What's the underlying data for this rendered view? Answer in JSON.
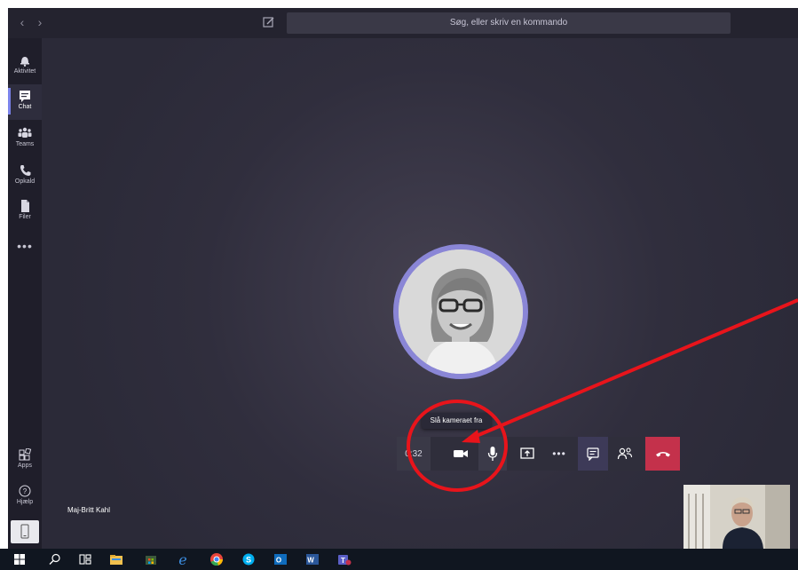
{
  "topbar": {
    "back_icon": "chevron-left-icon",
    "forward_icon": "chevron-right-icon",
    "compose_icon": "compose-icon",
    "search_placeholder": "Søg, eller skriv en kommando"
  },
  "rail": {
    "items": [
      {
        "label": "Aktivitet",
        "icon": "bell-icon",
        "active": false
      },
      {
        "label": "Chat",
        "icon": "chat-icon",
        "active": true
      },
      {
        "label": "Teams",
        "icon": "teams-icon",
        "active": false
      },
      {
        "label": "Opkald",
        "icon": "phone-icon",
        "active": false
      },
      {
        "label": "Filer",
        "icon": "file-icon",
        "active": false
      }
    ],
    "more": "•••",
    "bottom_items": [
      {
        "label": "Apps",
        "icon": "apps-icon"
      },
      {
        "label": "Hjælp",
        "icon": "help-icon"
      }
    ],
    "device_icon": "mobile-device-icon"
  },
  "call": {
    "participant_name": "Maj-Britt Kahl",
    "timer": "0:32",
    "tooltip": "Slå kameraet fra",
    "controls": {
      "camera_icon": "video-camera-icon",
      "mic_icon": "microphone-icon",
      "share_icon": "share-screen-icon",
      "more_label": "•••",
      "chat_icon": "conversation-icon",
      "participants_icon": "participants-icon",
      "hangup_icon": "hang-up-icon"
    }
  },
  "colors": {
    "stage_bg": "#2b2a3a",
    "rail_bg": "#1f1e2a",
    "accent": "#7b83eb",
    "hangup": "#c4314b",
    "annotation": "#e8141b"
  },
  "taskbar": {
    "icons": [
      "windows-start-icon",
      "search-icon",
      "task-view-icon",
      "file-explorer-icon",
      "store-icon",
      "edge-icon",
      "chrome-icon",
      "skype-icon",
      "outlook-icon",
      "word-icon",
      "teams-icon"
    ]
  }
}
